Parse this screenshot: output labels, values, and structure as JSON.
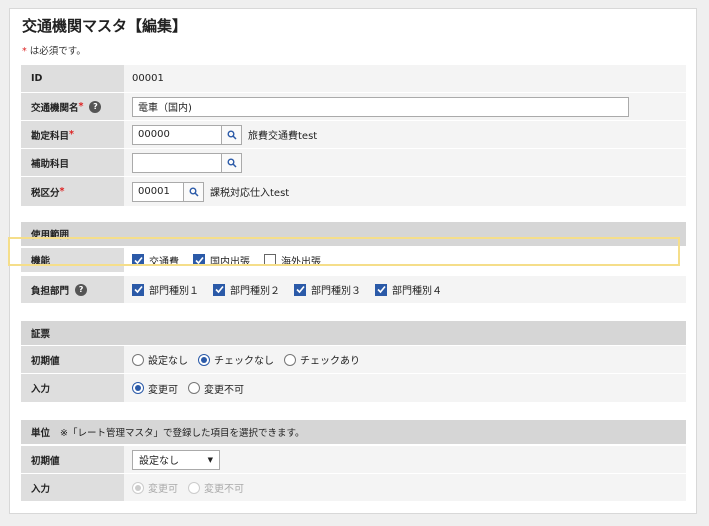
{
  "title": "交通機関マスタ【編集】",
  "req_note": "は必須です。",
  "req_star": "*",
  "fields": {
    "id": {
      "label": "ID",
      "value": "00001"
    },
    "name": {
      "label": "交通機関名",
      "value": "電車（国内)"
    },
    "account": {
      "label": "勘定科目",
      "value": "00000",
      "desc": "旅費交通費test"
    },
    "sub_account": {
      "label": "補助科目",
      "value": ""
    },
    "tax": {
      "label": "税区分",
      "value": "00001",
      "desc": "課税対応仕入test"
    }
  },
  "usage": {
    "section": "使用範囲",
    "function": {
      "label": "機能",
      "options": [
        {
          "label": "交通費",
          "checked": true
        },
        {
          "label": "国内出張",
          "checked": true
        },
        {
          "label": "海外出張",
          "checked": false
        }
      ]
    },
    "dept": {
      "label": "負担部門",
      "options": [
        {
          "label": "部門種別１",
          "checked": true
        },
        {
          "label": "部門種別２",
          "checked": true
        },
        {
          "label": "部門種別３",
          "checked": true
        },
        {
          "label": "部門種別４",
          "checked": true
        }
      ]
    }
  },
  "receipt": {
    "section": "証票",
    "initial": {
      "label": "初期値",
      "options": [
        "設定なし",
        "チェックなし",
        "チェックあり"
      ],
      "selected": 1
    },
    "input": {
      "label": "入力",
      "options": [
        "変更可",
        "変更不可"
      ],
      "selected": 0
    }
  },
  "unit": {
    "section": "単位",
    "note": "※「レート管理マスタ」で登録した項目を選択できます。",
    "initial": {
      "label": "初期値",
      "value": "設定なし"
    },
    "input": {
      "label": "入力",
      "options": [
        "変更可",
        "変更不可"
      ],
      "selected": 0,
      "disabled": true
    }
  },
  "colors": {
    "accent": "#2b5aa8",
    "required": "#dd2222",
    "highlight": "#f5de8a"
  }
}
